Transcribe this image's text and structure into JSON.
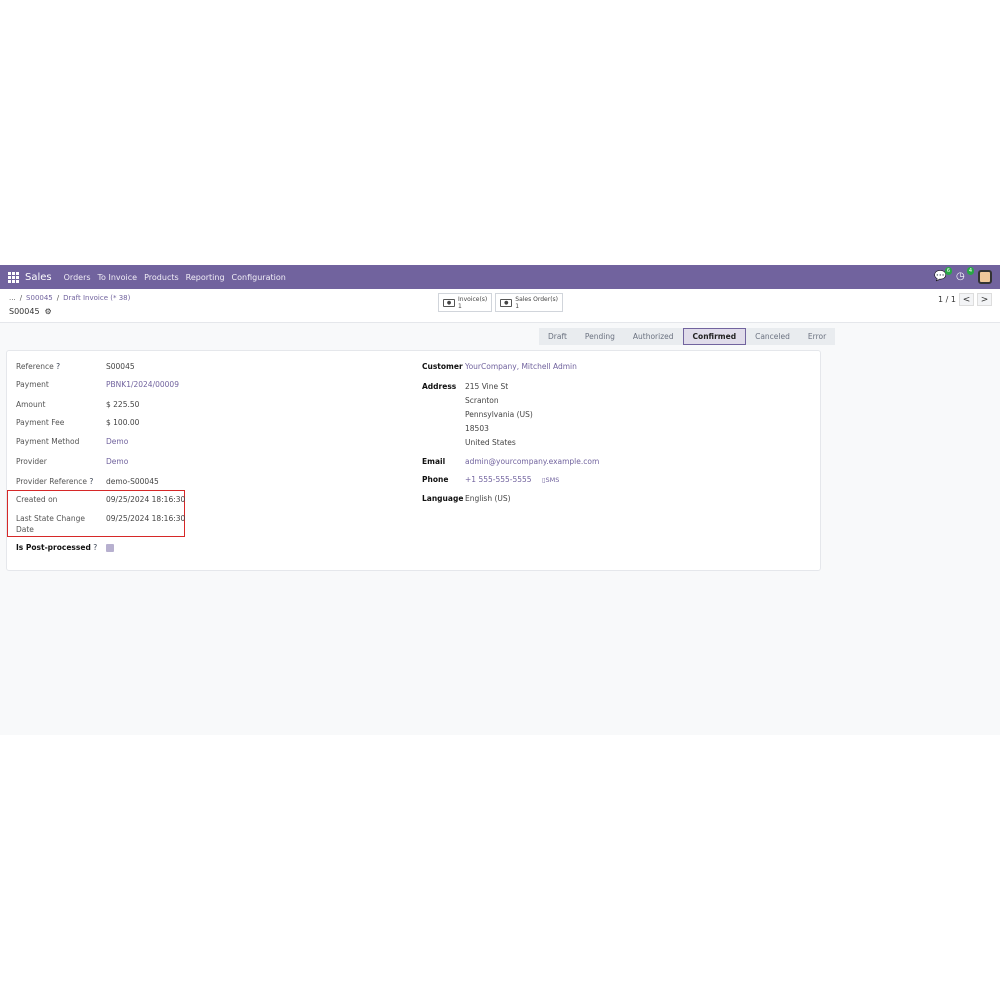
{
  "navbar": {
    "app_name": "Sales",
    "menu": [
      "Orders",
      "To Invoice",
      "Products",
      "Reporting",
      "Configuration"
    ],
    "messages_badge": "6",
    "activities_badge": "4"
  },
  "breadcrumb": {
    "ellipsis": "...",
    "sep1": "/",
    "item1": "S00045",
    "sep2": "/",
    "item2": "Draft Invoice (* 38)"
  },
  "record": {
    "title": "S00045"
  },
  "smart_buttons": [
    {
      "label": "Invoice(s)",
      "count": "1"
    },
    {
      "label": "Sales Order(s)",
      "count": "1"
    }
  ],
  "pager": {
    "value": "1 / 1",
    "prev": "<",
    "next": ">"
  },
  "statusbar": [
    "Draft",
    "Pending",
    "Authorized",
    "Confirmed",
    "Canceled",
    "Error"
  ],
  "status_active": "Confirmed",
  "left_fields": {
    "reference": {
      "label": "Reference",
      "value": "S00045"
    },
    "payment": {
      "label": "Payment",
      "value": "PBNK1/2024/00009"
    },
    "amount": {
      "label": "Amount",
      "value": "$ 225.50"
    },
    "payment_fee": {
      "label": "Payment Fee",
      "value": "$ 100.00"
    },
    "payment_method": {
      "label": "Payment Method",
      "value": "Demo"
    },
    "provider": {
      "label": "Provider",
      "value": "Demo"
    },
    "provider_reference": {
      "label": "Provider Reference",
      "value": "demo-S00045"
    },
    "created_on": {
      "label": "Created on",
      "value": "09/25/2024 18:16:30"
    },
    "last_state_change": {
      "label1": "Last State Change",
      "label2": "Date",
      "value": "09/25/2024 18:16:30"
    },
    "post_processed": {
      "label": "Is Post-processed",
      "checked": true
    }
  },
  "right_fields": {
    "customer": {
      "label": "Customer",
      "value": "YourCompany, Mitchell Admin"
    },
    "address": {
      "label": "Address",
      "lines": [
        "215 Vine St",
        "Scranton",
        "Pennsylvania (US)",
        "18503",
        "United States"
      ]
    },
    "email": {
      "label": "Email",
      "value": "admin@yourcompany.example.com"
    },
    "phone": {
      "label": "Phone",
      "value": "+1 555-555-5555",
      "sms": "SMS"
    },
    "language": {
      "label": "Language",
      "value": "English (US)"
    }
  },
  "help_mark": "?",
  "colors": {
    "brand": "#71639e",
    "highlight": "#d62828"
  }
}
